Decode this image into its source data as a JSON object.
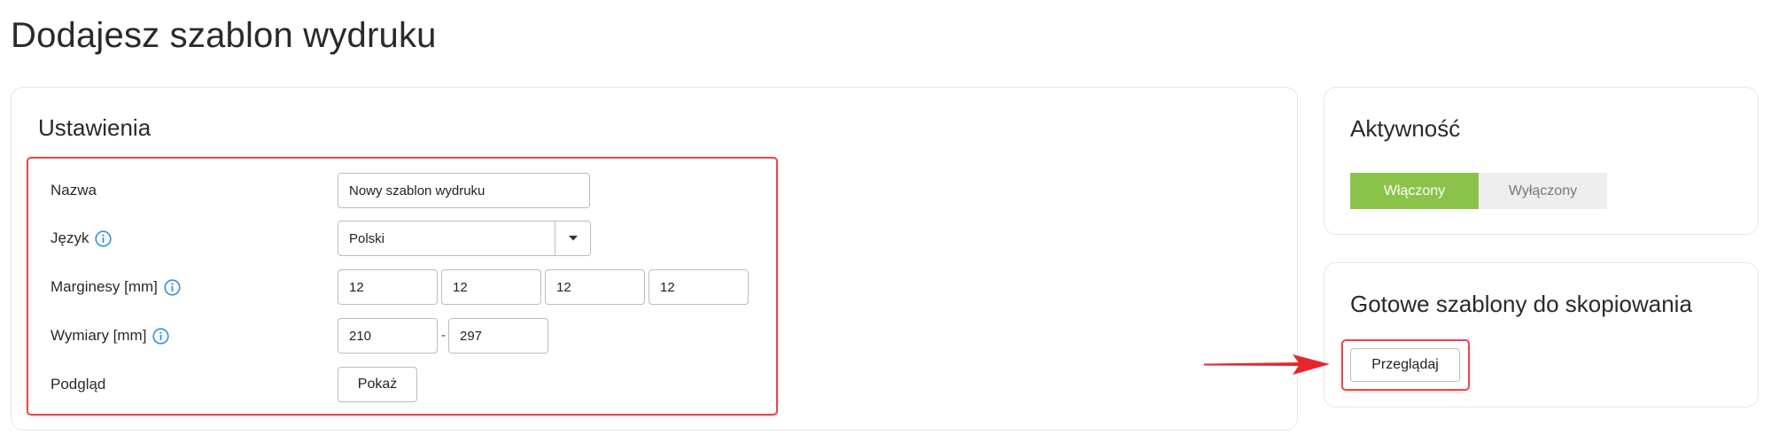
{
  "page": {
    "title": "Dodajesz szablon wydruku"
  },
  "settings": {
    "title": "Ustawienia",
    "name_label": "Nazwa",
    "name_value": "Nowy szablon wydruku",
    "language_label": "Język",
    "language_value": "Polski",
    "margins_label": "Marginesy [mm]",
    "margins": [
      "12",
      "12",
      "12",
      "12"
    ],
    "dimensions_label": "Wymiary [mm]",
    "dimension_width": "210",
    "dimension_separator": "-",
    "dimension_height": "297",
    "preview_label": "Podgląd",
    "preview_button": "Pokaż"
  },
  "activity": {
    "title": "Aktywność",
    "on_label": "Włączony",
    "off_label": "Wyłączony",
    "selected": "Włączony"
  },
  "templates": {
    "title": "Gotowe szablony do skopiowania",
    "browse_button": "Przeglądaj"
  },
  "icons": {
    "info": "info-icon",
    "dropdown": "chevron-down-icon",
    "arrow": "red-arrow-annotation"
  },
  "colors": {
    "accent_green": "#8bc34a",
    "highlight_red": "#e5484d",
    "info_blue": "#2f8fe8"
  }
}
